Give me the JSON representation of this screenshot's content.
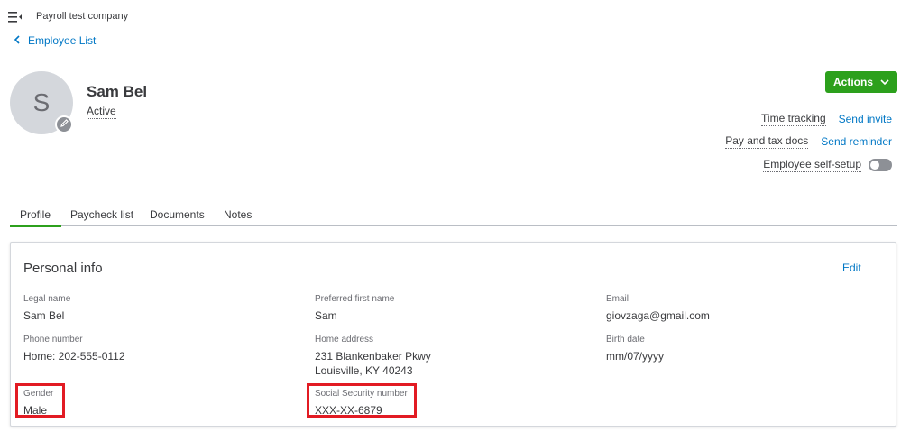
{
  "header": {
    "company_name": "Payroll test company",
    "menu_icon": "hamburger-collapse-icon"
  },
  "nav": {
    "back_label": "Employee List"
  },
  "employee": {
    "avatar_initial": "S",
    "name": "Sam Bel",
    "status": "Active"
  },
  "actions": {
    "button_label": "Actions",
    "time_tracking_label": "Time tracking",
    "send_invite_label": "Send invite",
    "pay_tax_docs_label": "Pay and tax docs",
    "send_reminder_label": "Send reminder",
    "self_setup_label": "Employee self-setup",
    "self_setup_enabled": false
  },
  "tabs": [
    {
      "label": "Profile",
      "active": true
    },
    {
      "label": "Paycheck list",
      "active": false
    },
    {
      "label": "Documents",
      "active": false
    },
    {
      "label": "Notes",
      "active": false
    }
  ],
  "personal_info": {
    "title": "Personal info",
    "edit_label": "Edit",
    "fields": {
      "legal_name": {
        "label": "Legal name",
        "value": "Sam Bel"
      },
      "preferred_first_name": {
        "label": "Preferred first name",
        "value": "Sam"
      },
      "email": {
        "label": "Email",
        "value": "giovzaga@gmail.com"
      },
      "phone_number": {
        "label": "Phone number",
        "value": "Home: 202-555-0112"
      },
      "home_address": {
        "label": "Home address",
        "line1": "231 Blankenbaker Pkwy",
        "line2": "Louisville, KY 40243"
      },
      "birth_date": {
        "label": "Birth date",
        "value": "mm/07/yyyy"
      },
      "gender": {
        "label": "Gender",
        "value": "Male"
      },
      "ssn": {
        "label": "Social Security number",
        "value": "XXX-XX-6879"
      }
    }
  },
  "colors": {
    "brand_green": "#2ca01c",
    "link_blue": "#0077c5",
    "highlight_red": "#e21b23"
  }
}
